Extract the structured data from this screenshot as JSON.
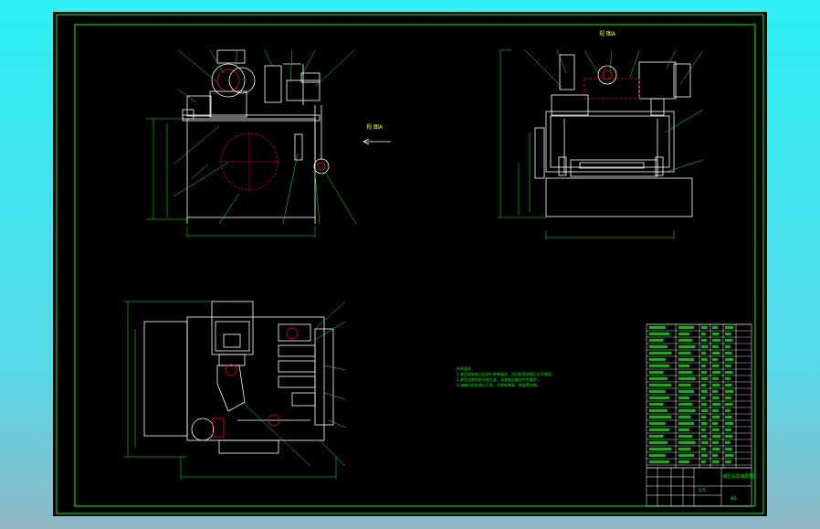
{
  "drawing": {
    "view_labels": {
      "side": "视 图A",
      "front_arrow": "视 图A"
    },
    "notes": {
      "title": "技术要求",
      "lines": [
        "1.液压站安装后应进行系统清洗、试压检验合格后方可使用；",
        "2.液压油使用前须经过滤，油液清洁度应符合要求；",
        "3.油箱内部应清洁干净，不得有铁屑、焊渣等杂物。"
      ]
    },
    "title_block": {
      "name": "液压站总装配图",
      "scale": "1:5",
      "sheet": "A0"
    }
  },
  "colors": {
    "background": "#000000",
    "frame": "#00ff00",
    "outline": "#ffffff",
    "leader": "#00ff00",
    "highlight": "#ff0000",
    "dimension": "#ffff00",
    "tank": "#ffffff"
  }
}
